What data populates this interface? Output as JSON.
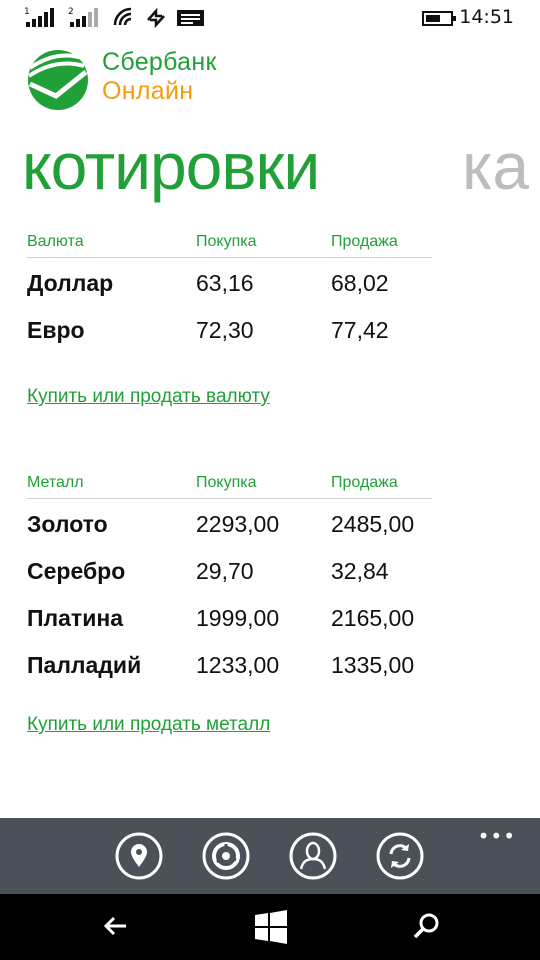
{
  "status_bar": {
    "sim1_label": "1",
    "sim2_label": "2",
    "time": "14:51"
  },
  "logo": {
    "line1": "Сбербанк",
    "line2": "Онлайн",
    "colors": {
      "green": "#21a038",
      "orange": "#f39b12"
    }
  },
  "pivot": {
    "current": "котировки",
    "next": "ка"
  },
  "currency_table": {
    "headers": [
      "Валюта",
      "Покупка",
      "Продажа"
    ],
    "rows": [
      {
        "name": "Доллар",
        "buy": "63,16",
        "sell": "68,02"
      },
      {
        "name": "Евро",
        "buy": "72,30",
        "sell": "77,42"
      }
    ],
    "link": "Купить или продать валюту"
  },
  "metal_table": {
    "headers": [
      "Металл",
      "Покупка",
      "Продажа"
    ],
    "rows": [
      {
        "name": "Золото",
        "buy": "2293,00",
        "sell": "2485,00"
      },
      {
        "name": "Серебро",
        "buy": "29,70",
        "sell": "32,84"
      },
      {
        "name": "Платина",
        "buy": "1999,00",
        "sell": "2165,00"
      },
      {
        "name": "Палладий",
        "buy": "1233,00",
        "sell": "1335,00"
      }
    ],
    "link": "Купить или продать металл"
  },
  "app_bar": {
    "buttons": [
      "location-pin-icon",
      "rates-dial-icon",
      "person-icon",
      "refresh-icon"
    ],
    "more": "•••",
    "background": "#4a5158"
  },
  "nav_bar": {
    "buttons": [
      "back-arrow-icon",
      "windows-start-icon",
      "search-icon"
    ]
  }
}
